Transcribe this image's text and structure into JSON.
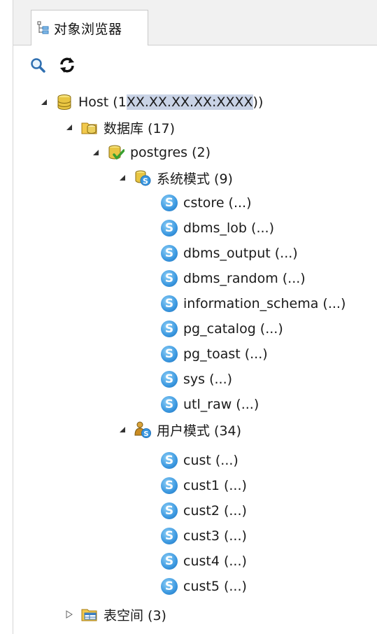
{
  "panel": {
    "tab_label": "对象浏览器"
  },
  "toolbar": {
    "search_icon": "search-icon",
    "refresh_icon": "refresh-icon"
  },
  "tree": {
    "host": {
      "prefix": "Host (1",
      "masked": "XX.XX.XX.XX:XXXX",
      "suffix": "))"
    },
    "databases": {
      "label": "数据库 (17)"
    },
    "postgres": {
      "label": "postgres (2)"
    },
    "system_schemas": {
      "label": "系统模式 (9)",
      "items": [
        "cstore (...)",
        "dbms_lob (...)",
        "dbms_output (...)",
        "dbms_random (...)",
        "information_schema (...)",
        "pg_catalog (...)",
        "pg_toast (...)",
        "sys (...)",
        "utl_raw (...)"
      ]
    },
    "user_schemas": {
      "label": "用户模式 (34)",
      "items": [
        "cust (...)",
        "cust1 (...)",
        "cust2 (...)",
        "cust3 (...)",
        "cust4 (...)",
        "cust5 (...)"
      ]
    },
    "tablespaces": {
      "label": "表空间 (3)"
    }
  },
  "colors": {
    "selection_mask": "#c9d3e6",
    "schema_icon": "#3b98e0"
  }
}
